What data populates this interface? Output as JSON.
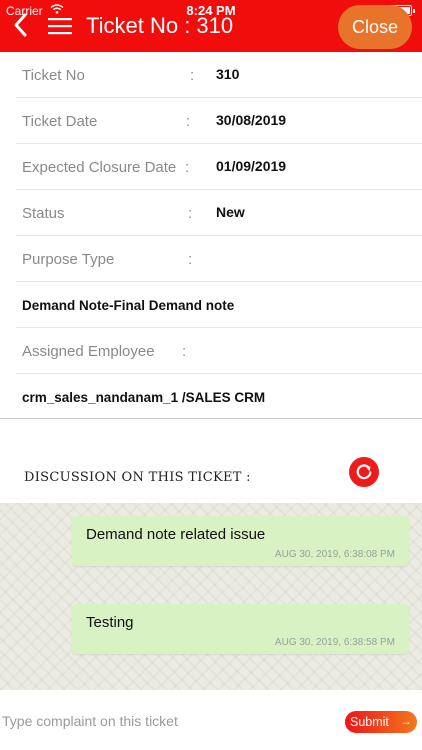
{
  "status_bar": {
    "carrier": "Carrier",
    "time": "8:24 PM"
  },
  "header": {
    "title": "Ticket No : 310",
    "close_label": "Close",
    "bar_color": "#f20d0d",
    "close_color": "#e8742c"
  },
  "details": {
    "ticket_no": {
      "label": "Ticket No",
      "colon": ":",
      "value": "310"
    },
    "ticket_date": {
      "label": "Ticket Date",
      "colon": ":",
      "value": "30/08/2019"
    },
    "expected_closure": {
      "label": "Expected Closure Date",
      "colon": ":",
      "value": "01/09/2019"
    },
    "status": {
      "label": "Status",
      "colon": ":",
      "value": "New"
    },
    "purpose_type": {
      "label": "Purpose Type",
      "colon": ":",
      "value": "Demand Note-Final Demand note"
    },
    "assigned_employee": {
      "label": "Assigned Employee",
      "colon": ":",
      "value": "crm_sales_nandanam_1 /SALES CRM"
    }
  },
  "discussion": {
    "title": "DISCUSSION ON THIS TICKET :",
    "messages": [
      {
        "text": "Demand note related issue",
        "timestamp": "AUG 30, 2019, 6:38:08 PM"
      },
      {
        "text": "Testing",
        "timestamp": "AUG 30, 2019, 6:38:58 PM"
      }
    ]
  },
  "composer": {
    "placeholder": "Type complaint on this ticket",
    "submit_label": "Submit",
    "arrow": "→"
  },
  "icons": {
    "back": "chevron-left-icon",
    "menu": "hamburger-menu-icon",
    "refresh": "refresh-icon",
    "wifi": "wifi-icon",
    "battery": "battery-icon"
  }
}
